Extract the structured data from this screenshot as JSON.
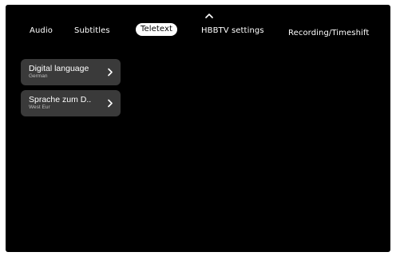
{
  "tabs": {
    "audio": "Audio",
    "subtitles": "Subtitles",
    "teletext": "Teletext",
    "hbbtv": "HBBTV settings",
    "recording": "Recording/Timeshift",
    "selected": "Teletext"
  },
  "menu": {
    "items": [
      {
        "title": "Digital language",
        "value": "German"
      },
      {
        "title": "Sprache zum D..",
        "value": "West Eur"
      }
    ]
  },
  "icons": {
    "up": "chevron-up-icon",
    "item": "chevron-right-icon"
  },
  "colors": {
    "background": "#000000",
    "item_background": "#3a3a3a",
    "selected_tab_background": "#ffffff",
    "selected_tab_text": "#000000",
    "text": "#ffffff",
    "secondary_text": "#bdbdbd"
  }
}
